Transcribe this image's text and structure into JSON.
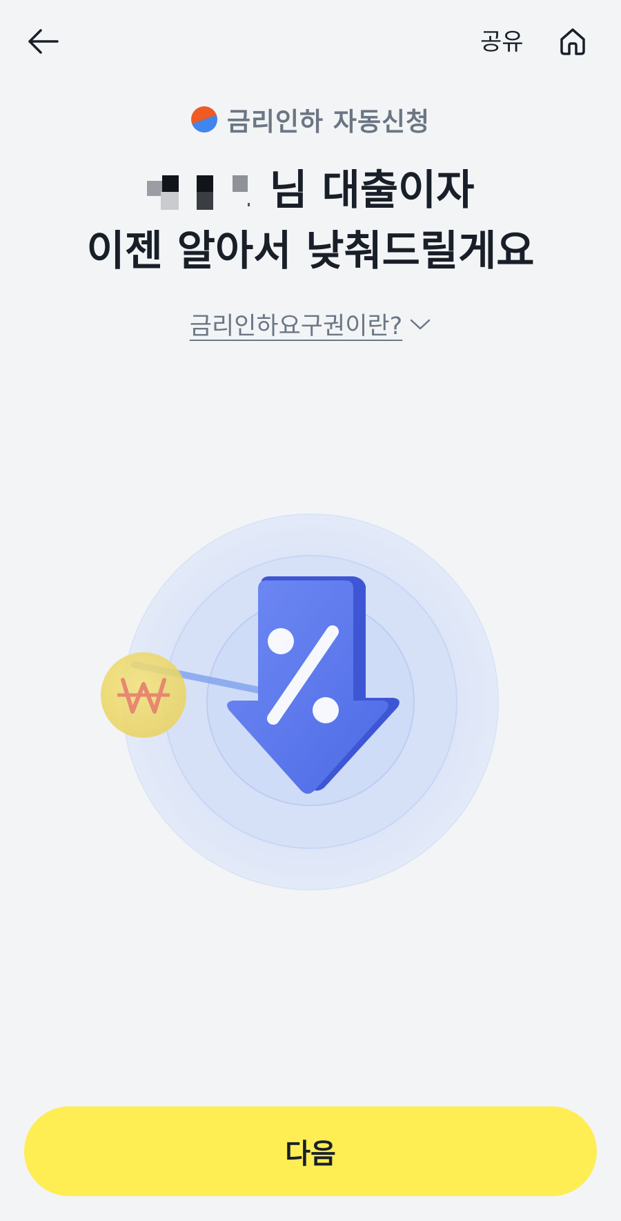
{
  "header": {
    "back_icon": "arrow-left-icon",
    "share_label": "공유",
    "home_icon": "home-icon"
  },
  "service": {
    "icon": "taegeuk-dot-icon",
    "label": "금리인하 자동신청"
  },
  "headline": {
    "name_masked": true,
    "line1_suffix": "님 대출이자",
    "line2": "이젠 알아서 낮춰드릴게요"
  },
  "faq": {
    "label": "금리인하요구권이란?",
    "icon": "chevron-down-icon"
  },
  "illustration": {
    "coin_icon": "won-coin-icon",
    "arrow_icon": "percent-down-arrow-icon"
  },
  "footer": {
    "next_label": "다음"
  },
  "colors": {
    "background": "#f2f4f6",
    "primary_button": "#feed53",
    "text_primary": "#191f28",
    "text_secondary": "#6b7684",
    "accent_blue": "#5b7cf0"
  }
}
